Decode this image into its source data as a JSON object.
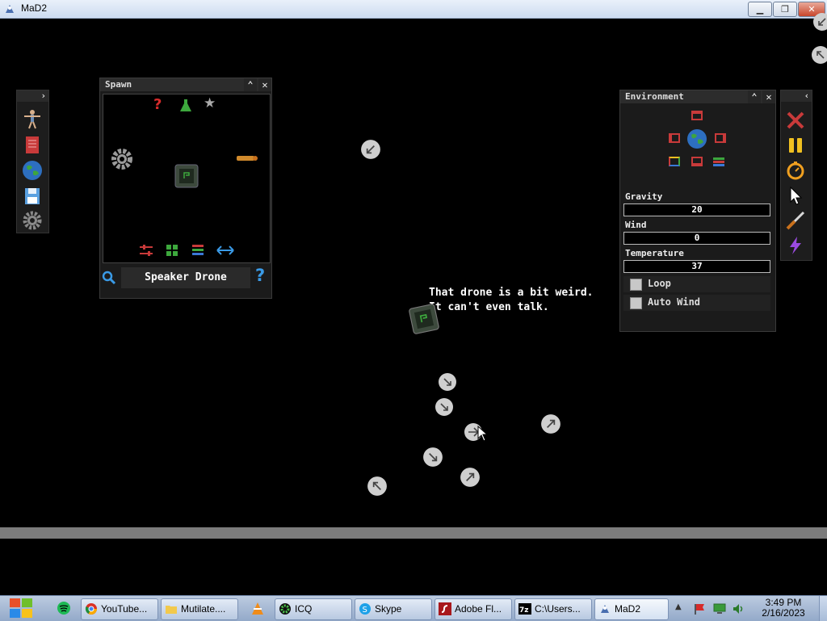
{
  "window": {
    "title": "MaD2"
  },
  "spawn_panel": {
    "title": "Spawn",
    "selected_item": "Speaker Drone"
  },
  "environment_panel": {
    "title": "Environment",
    "gravity": {
      "label": "Gravity",
      "value": "20"
    },
    "wind": {
      "label": "Wind",
      "value": "0"
    },
    "temperature": {
      "label": "Temperature",
      "value": "37"
    },
    "loop": {
      "label": "Loop",
      "checked": false
    },
    "auto_wind": {
      "label": "Auto Wind",
      "checked": false
    }
  },
  "speech_bubble": {
    "line1": "That drone is a bit weird.",
    "line2": "It can't even talk."
  },
  "taskbar": {
    "items": [
      {
        "label": "YouTube..."
      },
      {
        "label": "Mutilate...."
      },
      {
        "label": "ICQ"
      },
      {
        "label": "Skype"
      },
      {
        "label": "Adobe Fl..."
      },
      {
        "label": "C:\\Users..."
      },
      {
        "label": "MaD2"
      }
    ],
    "time": "3:49 PM",
    "date": "2/16/2023"
  },
  "colors": {
    "accent_red": "#c83a3a",
    "accent_yellow": "#f0c020",
    "ground": "#7c7c7c"
  }
}
